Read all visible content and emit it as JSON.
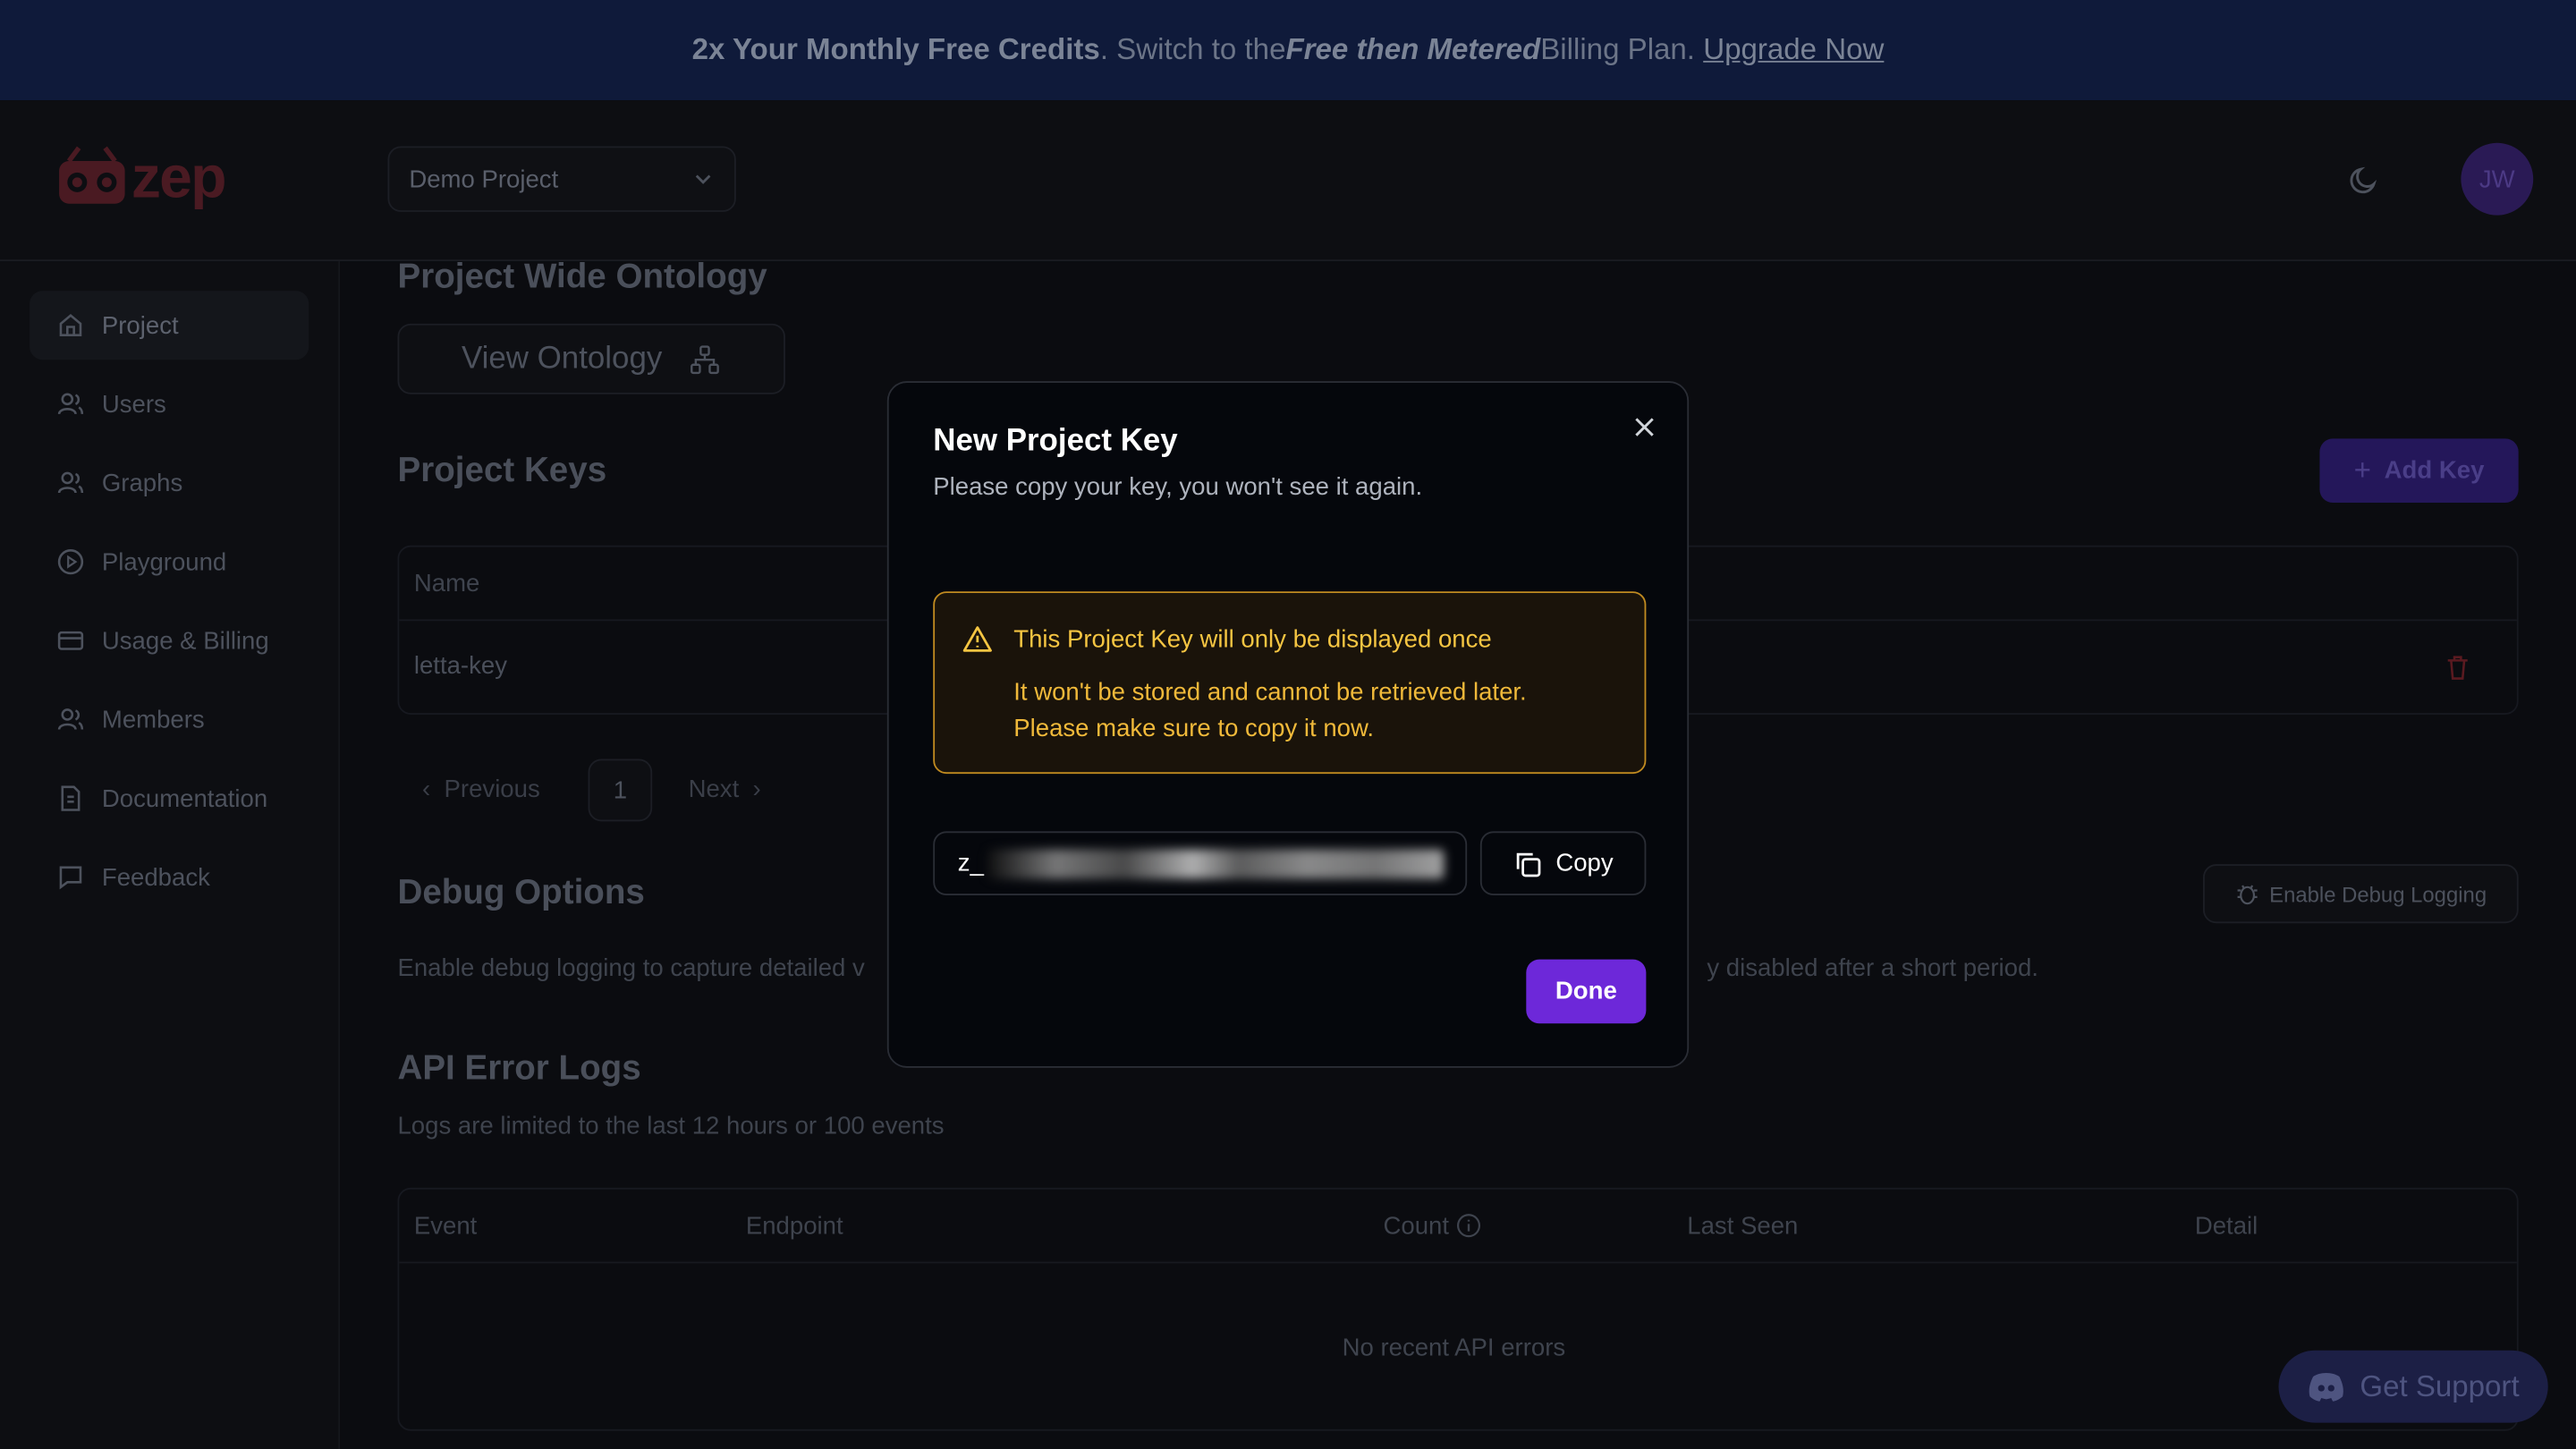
{
  "banner": {
    "part1": "2x Your Monthly Free Credits",
    "part2": ". Switch to the ",
    "part3": "Free then Metered",
    "part4": " Billing Plan.",
    "link": "Upgrade Now"
  },
  "header": {
    "logo_text": "zep",
    "project_select": "Demo Project",
    "avatar_initials": "JW"
  },
  "sidebar": {
    "items": [
      {
        "label": "Project",
        "icon": "home-icon"
      },
      {
        "label": "Users",
        "icon": "users-icon"
      },
      {
        "label": "Graphs",
        "icon": "graph-icon"
      },
      {
        "label": "Playground",
        "icon": "play-icon"
      },
      {
        "label": "Usage & Billing",
        "icon": "credit-card-icon"
      },
      {
        "label": "Members",
        "icon": "members-icon"
      },
      {
        "label": "Documentation",
        "icon": "document-icon"
      },
      {
        "label": "Feedback",
        "icon": "chat-icon"
      }
    ]
  },
  "main": {
    "ontology_title": "Project Wide Ontology",
    "view_ontology": "View Ontology",
    "keys_title": "Project Keys",
    "add_key": "Add Key",
    "keys_table": {
      "header_name": "Name",
      "rows": [
        {
          "name": "letta-key"
        }
      ]
    },
    "pagination": {
      "previous": "Previous",
      "page": "1",
      "next": "Next"
    },
    "debug_title": "Debug Options",
    "debug_button": "Enable Debug Logging",
    "debug_desc_left": "Enable debug logging to capture detailed v",
    "debug_desc_right": "y disabled after a short period.",
    "errors_title": "API Error Logs",
    "errors_desc": "Logs are limited to the last 12 hours or 100 events",
    "errors_table": {
      "columns": [
        "Event",
        "Endpoint",
        "Count",
        "Last Seen",
        "Detail"
      ],
      "empty": "No recent API errors"
    },
    "support": "Get Support"
  },
  "modal": {
    "title": "New Project Key",
    "subtitle": "Please copy your key, you won't see it again.",
    "warning_title": "This Project Key will only be displayed once",
    "warning_line1": "It won't be stored and cannot be retrieved later.",
    "warning_line2": "Please make sure to copy it now.",
    "key_prefix": "z_",
    "copy": "Copy",
    "done": "Done"
  },
  "colors": {
    "accent": "#6d28d9",
    "warning": "#f5c542",
    "banner_bg": "#0f1a3a"
  }
}
